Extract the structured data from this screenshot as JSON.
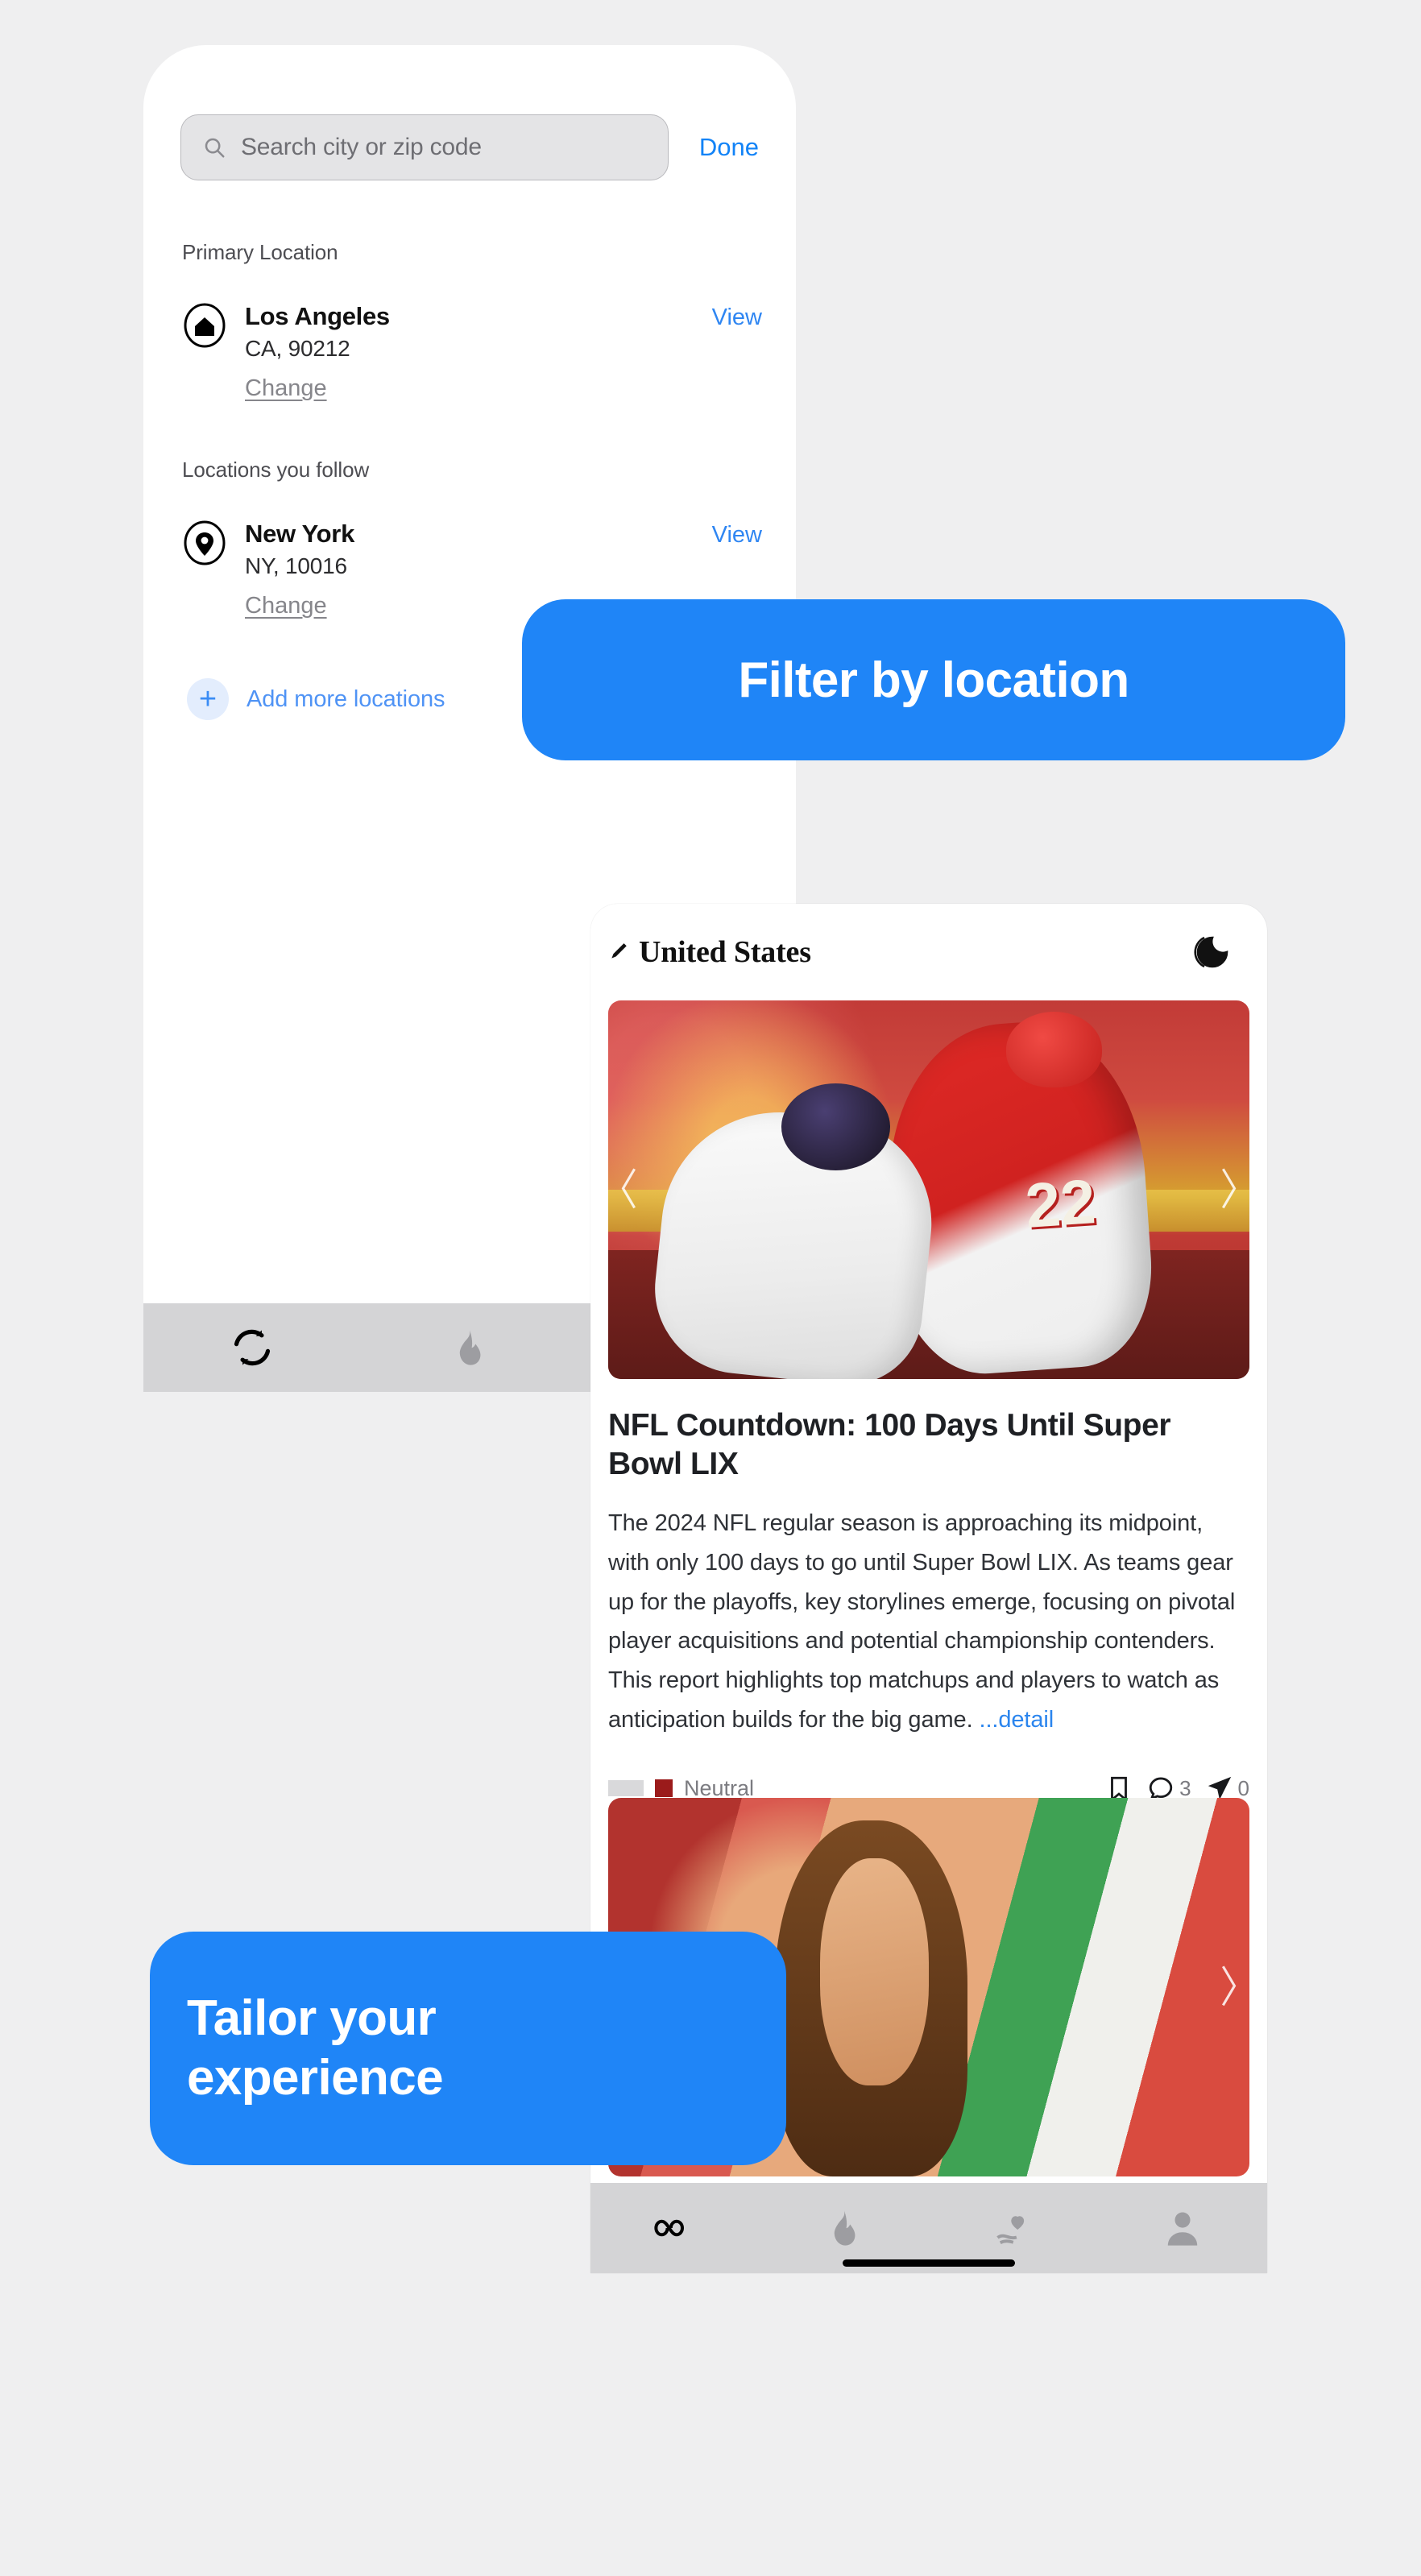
{
  "locations_screen": {
    "search": {
      "placeholder": "Search city or zip code",
      "icon": "search-icon"
    },
    "done_label": "Done",
    "primary_section_label": "Primary Location",
    "follow_section_label": "Locations you follow",
    "primary": {
      "icon": "home-icon",
      "name": "Los Angeles",
      "detail": "CA, 90212",
      "view_label": "View",
      "change_label": "Change"
    },
    "followed": [
      {
        "icon": "map-pin-icon",
        "name": "New York",
        "detail": "NY, 10016",
        "view_label": "View",
        "change_label": "Change"
      }
    ],
    "add_more_label": "Add more locations",
    "add_more_icon": "plus-icon",
    "tabs": [
      {
        "icon": "refresh-icon",
        "active": true
      },
      {
        "icon": "flame-icon",
        "active": false
      },
      {
        "icon": "heart-in-hand-icon",
        "active": false
      }
    ]
  },
  "feed_screen": {
    "header": {
      "edit_icon": "pencil-icon",
      "title": "United States",
      "theme_icon": "moon-icon"
    },
    "articles": [
      {
        "image_alt": "nfl-players-tackle",
        "prev_icon": "chevron-left-icon",
        "next_icon": "chevron-right-icon",
        "title": "NFL Countdown: 100 Days Until Super Bowl LIX",
        "body": "The 2024 NFL regular season is approaching its midpoint, with only 100 days to go until Super Bowl LIX. As teams gear up for the playoffs, key storylines emerge, focusing on pivotal player acquisitions and potential championship contenders. This report highlights top matchups and players to watch as anticipation builds for the big game. ",
        "detail_label": "...detail",
        "sentiment_label": "Neutral",
        "sentiment_color": "#9b1b1b",
        "actions": {
          "bookmark_icon": "bookmark-icon",
          "comment_icon": "comment-icon",
          "comment_count": "3",
          "share_icon": "share-icon",
          "share_count": "0"
        }
      },
      {
        "image_alt": "woman-with-flag-background",
        "prev_icon": "chevron-left-icon",
        "next_icon": "chevron-right-icon"
      }
    ],
    "tabs": [
      {
        "icon": "infinity-icon",
        "active": true
      },
      {
        "icon": "flame-icon",
        "active": false
      },
      {
        "icon": "heart-in-hand-icon",
        "active": false
      },
      {
        "icon": "person-icon",
        "active": false
      }
    ]
  },
  "callouts": {
    "filter": "Filter by location",
    "tailor_line1": "Tailor your",
    "tailor_line2": "experience",
    "accent_color": "#1f85f7"
  }
}
